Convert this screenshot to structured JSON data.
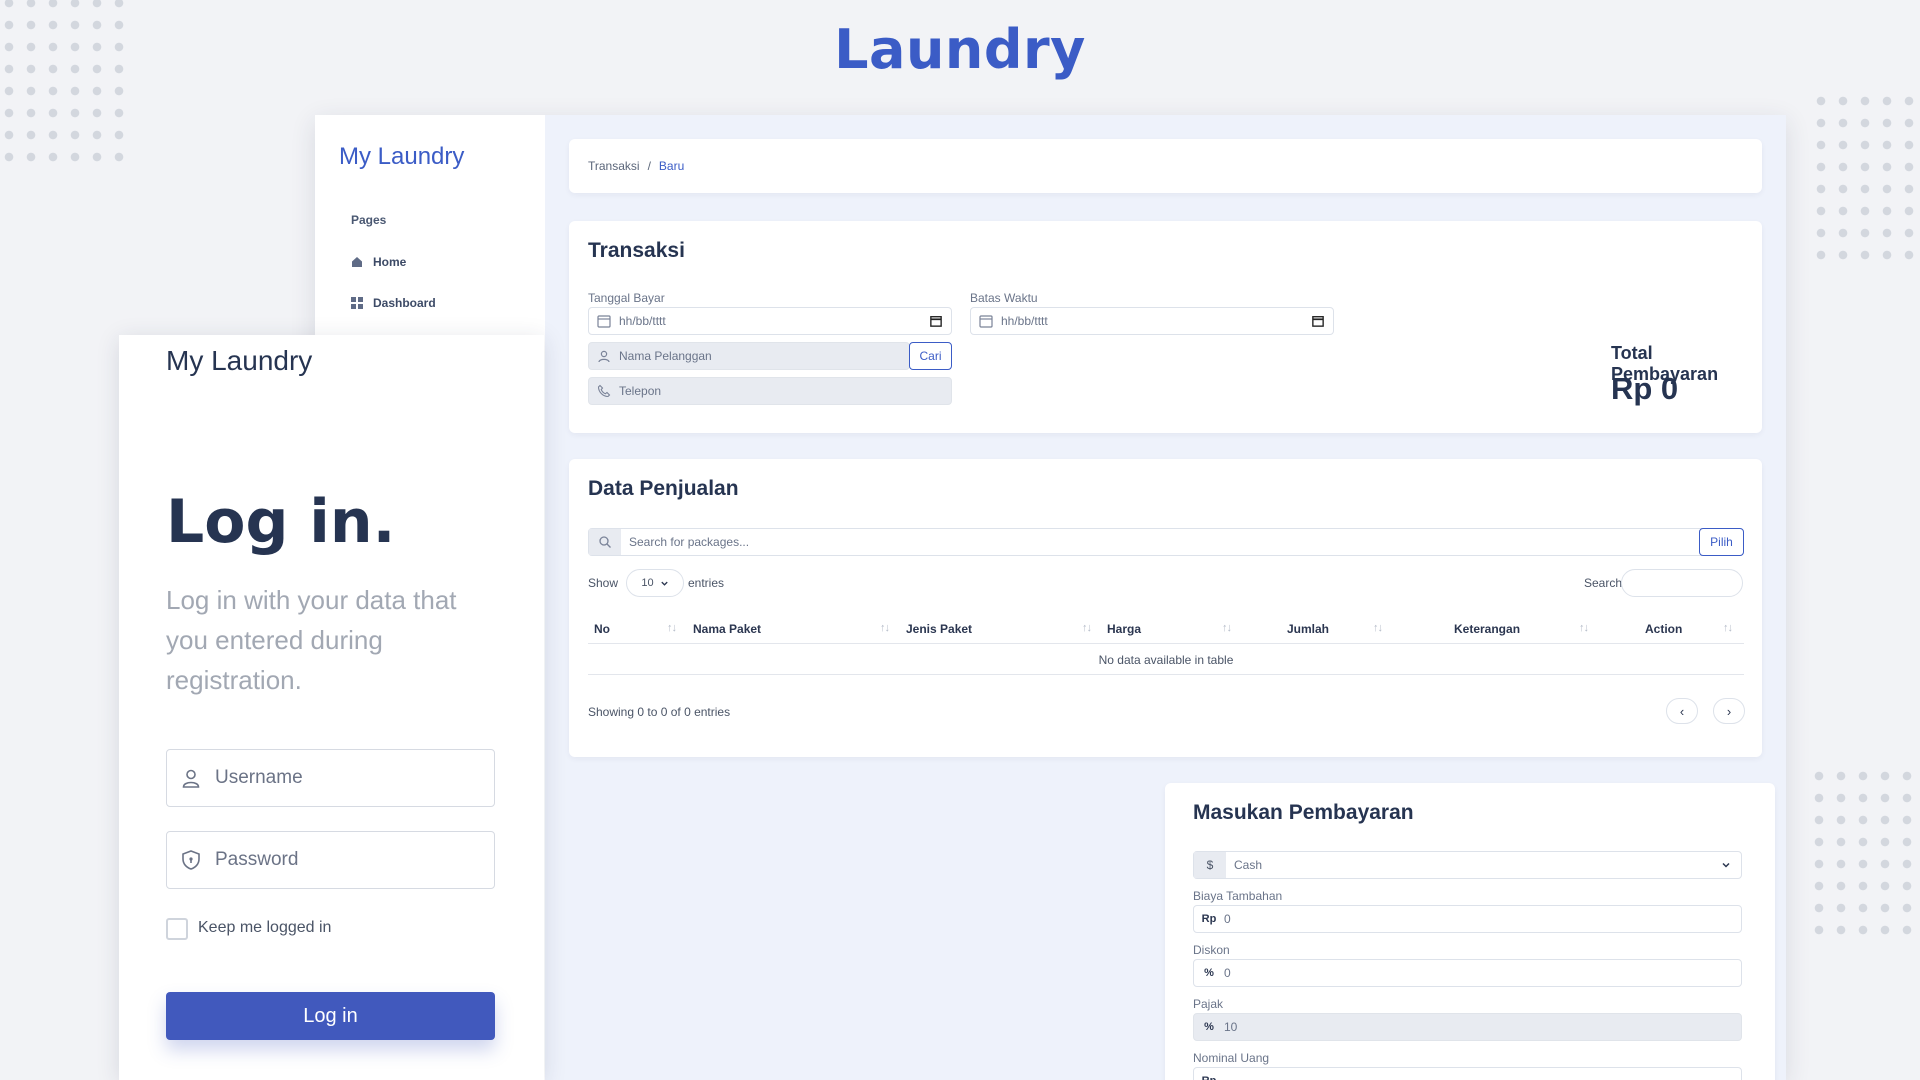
{
  "page": {
    "title": "Laundry"
  },
  "sidebar": {
    "brand": "My Laundry",
    "section": "Pages",
    "items": [
      {
        "label": "Home",
        "icon": "home-icon"
      },
      {
        "label": "Dashboard",
        "icon": "grid-icon"
      }
    ]
  },
  "breadcrumb": {
    "parent": "Transaksi",
    "separator": "/",
    "current": "Baru"
  },
  "transaksi": {
    "title": "Transaksi",
    "tanggal_bayar": {
      "label": "Tanggal Bayar",
      "placeholder": "hh/bb/tttt"
    },
    "batas_waktu": {
      "label": "Batas Waktu",
      "placeholder": "hh/bb/tttt"
    },
    "customer": {
      "placeholder": "Nama Pelanggan",
      "button": "Cari"
    },
    "phone": {
      "placeholder": "Telepon"
    },
    "total": {
      "label": "Total Pembayaran",
      "value": "Rp 0"
    }
  },
  "penjualan": {
    "title": "Data Penjualan",
    "search_placeholder": "Search for packages...",
    "pick_button": "Pilih",
    "show_label": "Show",
    "page_size": "10",
    "entries_label": "entries",
    "search_label": "Search:",
    "columns": [
      "No",
      "Nama Paket",
      "Jenis Paket",
      "Harga",
      "Jumlah",
      "Keterangan",
      "Action"
    ],
    "empty_text": "No data available in table",
    "info_text": "Showing 0 to 0 of 0 entries",
    "prev": "‹",
    "next": "›"
  },
  "pembayaran": {
    "title": "Masukan Pembayaran",
    "method": {
      "prefix": "$",
      "value": "Cash"
    },
    "biaya": {
      "label": "Biaya Tambahan",
      "prefix": "Rp",
      "value": "0"
    },
    "diskon": {
      "label": "Diskon",
      "prefix": "%",
      "value": "0"
    },
    "pajak": {
      "label": "Pajak",
      "prefix": "%",
      "value": "10"
    },
    "nominal": {
      "label": "Nominal Uang",
      "prefix": "Rp"
    }
  },
  "login": {
    "brand": "My Laundry",
    "title": "Log in.",
    "subtitle": "Log in with your data that you entered during registration.",
    "username_placeholder": "Username",
    "password_placeholder": "Password",
    "remember_label": "Keep me logged in",
    "submit": "Log in"
  },
  "colors": {
    "accent": "#3b5cc6",
    "button": "#4159bd",
    "background": "#f2f3f6",
    "panel": "#eef2fb"
  }
}
